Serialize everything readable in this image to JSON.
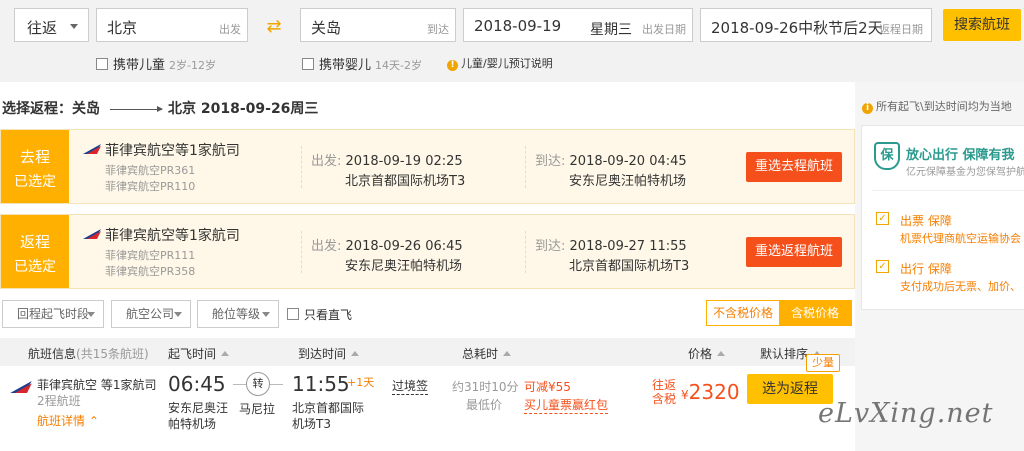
{
  "search": {
    "trip_type": "往返",
    "from_city": "北京",
    "from_hint": "出发",
    "to_city": "关岛",
    "to_hint": "到达",
    "depart_date": "2018-09-19",
    "depart_weekday": "星期三",
    "depart_hint": "出发日期",
    "return_date": "2018-09-26中秋节后2天",
    "return_hint": "返程日期",
    "search_button": "搜索航班",
    "child_label": "携带儿童",
    "child_age": "2岁-12岁",
    "infant_label": "携带婴儿",
    "infant_age": "14天-2岁",
    "info_link": "儿童/婴儿预订说明",
    "info_icon": "!"
  },
  "route_title": {
    "prefix": "选择返程：关岛",
    "suffix": "北京  2018-09-26周三"
  },
  "outbound": {
    "tag1": "去程",
    "tag2": "已选定",
    "airline": "菲律宾航空等1家航司",
    "flight1": "菲律宾航空PR361",
    "flight2": "菲律宾航空PR110",
    "dep_label": "出发:",
    "dep_time": "2018-09-19 02:25",
    "dep_airport": "北京首都国际机场T3",
    "arr_label": "到达:",
    "arr_time": "2018-09-20 04:45",
    "arr_airport": "安东尼奥汪帕特机场",
    "button": "重选去程航班"
  },
  "return_trip": {
    "tag1": "返程",
    "tag2": "已选定",
    "airline": "菲律宾航空等1家航司",
    "flight1": "菲律宾航空PR111",
    "flight2": "菲律宾航空PR358",
    "dep_label": "出发:",
    "dep_time": "2018-09-26 06:45",
    "dep_airport": "安东尼奥汪帕特机场",
    "arr_label": "到达:",
    "arr_time": "2018-09-27 11:55",
    "arr_airport": "北京首都国际机场T3",
    "button": "重选返程航班"
  },
  "filters": {
    "time": "回程起飞时段",
    "airline": "航空公司",
    "cabin": "舱位等级",
    "direct": "只看直飞",
    "excl_tax": "不含税价格",
    "incl_tax": "含税价格"
  },
  "list_header": {
    "info": "航班信息",
    "count": "(共15条航班)",
    "dep": "起飞时间",
    "arr": "到达时间",
    "dur": "总耗时",
    "price": "价格",
    "sort": "默认排序"
  },
  "flight": {
    "airline": "菲律宾航空 等1家航司",
    "type": "2程航班",
    "detail": "航班详情",
    "detail_icon": "⌃",
    "dep_time": "06:45",
    "dep_airport": "安东尼奥汪帕特机场",
    "stop": "转",
    "stop_city": "马尼拉",
    "arr_time": "11:55",
    "plus_day": "+1天",
    "transit": "过境签",
    "arr_airport": "北京首都国际机场T3",
    "duration": "约31时10分",
    "low_label": "最低价",
    "discount": "可减¥55",
    "child_red": "买儿童票赢红包",
    "price_label": "往返含税",
    "currency": "¥",
    "price": "2320",
    "book": "选为返程",
    "badge": "少量"
  },
  "sidebar": {
    "note": "所有起飞\\到达时间均为当地",
    "note_icon": "i",
    "shield_icon": "保",
    "title": "放心出行 保障有我",
    "subtitle": "亿元保障基金为您保驾护航",
    "item1_title": "出票 保障",
    "item1_desc": "机票代理商航空运输协会",
    "item2_title": "出行 保障",
    "item2_desc": "支付成功后无票、加价、",
    "check_icon": "✓"
  },
  "watermark": "eLvXing.net",
  "colors": {
    "accent": "#ffb000",
    "button": "#f5501c",
    "price": "#f5501c",
    "search_button": "#ffc000",
    "teal": "#2a9a8e"
  }
}
